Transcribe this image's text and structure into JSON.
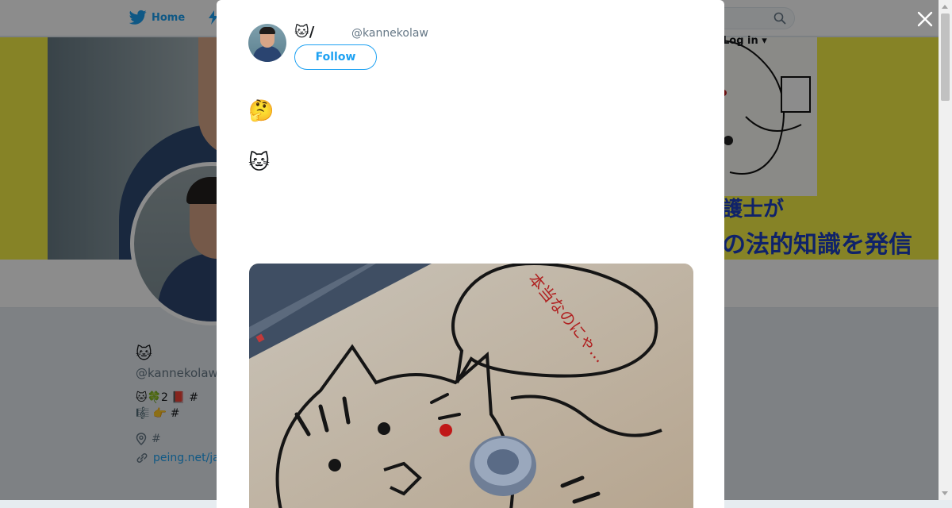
{
  "nav": {
    "home_label": "Home",
    "login_label": "Log in"
  },
  "banner": {
    "line1": "護士が",
    "line2": "の法的知識を発信"
  },
  "profile": {
    "name_line1": "🐱",
    "name_line2": "",
    "handle": "@kannekolaw",
    "bio_line1": "🐱🍀2 📕 #",
    "bio_line2": "🎼 👉 #",
    "location": "#",
    "url": "peing.net/ja"
  },
  "tweet": {
    "author_name": "🐱/",
    "author_handle": "@kannekolaw",
    "follow_label": "Follow",
    "paragraphs": [
      "",
      "",
      "🤔",
      "🐱"
    ],
    "media_text": "本当なのにゃ..."
  },
  "colors": {
    "accent": "#1da1f2",
    "banner_yellow": "#f4ee45",
    "banner_text": "#1d3fbf"
  }
}
